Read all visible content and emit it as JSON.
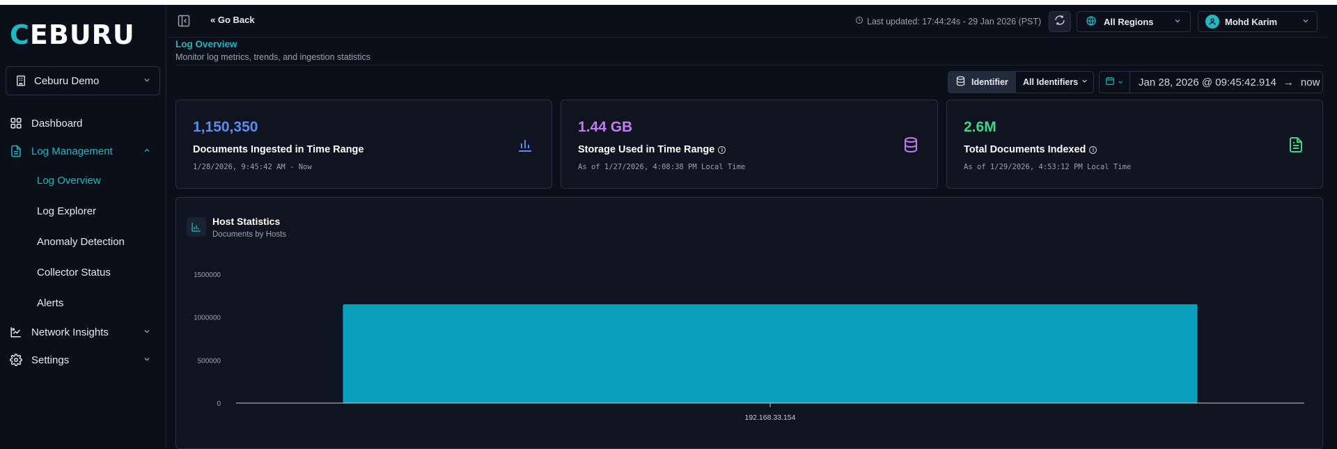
{
  "brand": {
    "logo_first": "C",
    "logo_rest": "EBURU"
  },
  "sidebar": {
    "workspace": "Ceburu Demo",
    "nav": [
      {
        "label": "Dashboard",
        "icon": "dashboard-icon"
      },
      {
        "label": "Log Management",
        "icon": "document-icon",
        "active": true,
        "expanded": true
      },
      {
        "label": "Network Insights",
        "icon": "network-chart-icon"
      },
      {
        "label": "Settings",
        "icon": "gear-icon"
      }
    ],
    "log_sub": [
      "Log Overview",
      "Log Explorer",
      "Anomaly Detection",
      "Collector Status",
      "Alerts"
    ],
    "active_sub": "Log Overview"
  },
  "topbar": {
    "go_back": "Go Back",
    "last_updated": "Last updated: 17:44:24s - 29 Jan 2026 (PST)",
    "region": "All Regions",
    "user": "Mohd Karim"
  },
  "page": {
    "title": "Log Overview",
    "subtitle": "Monitor log metrics, trends, and ingestion statistics"
  },
  "filters": {
    "identifier_label": "Identifier",
    "identifier_value": "All Identifiers",
    "range_from": "Jan 28, 2026 @ 09:45:42.914",
    "range_to": "now"
  },
  "cards": [
    {
      "value": "1,150,350",
      "label": "Documents Ingested in Time Range",
      "meta": "1/28/2026, 9:45:42 AM - Now",
      "color": "#5b8def",
      "icon": "bar-chart-icon"
    },
    {
      "value": "1.44 GB",
      "label": "Storage Used in Time Range",
      "meta": "As of 1/27/2026, 4:08:38 PM Local Time",
      "color": "#c17cf0",
      "icon": "database-icon"
    },
    {
      "value": "2.6M",
      "label": "Total Documents Indexed",
      "meta": "As of 1/29/2026, 4:53:12 PM Local Time",
      "color": "#3fd68a",
      "icon": "file-text-icon"
    }
  ],
  "panel": {
    "title": "Host Statistics",
    "subtitle": "Documents by Hosts"
  },
  "chart_data": {
    "type": "bar",
    "title": "Host Statistics",
    "subtitle": "Documents by Hosts",
    "categories": [
      "192.168.33.154"
    ],
    "values": [
      1150350
    ],
    "ylim": [
      0,
      1500000
    ],
    "yticks": [
      0,
      500000,
      1000000,
      1500000
    ],
    "ytick_labels": [
      "0",
      "500000",
      "1000000",
      "1500000"
    ],
    "bar_color": "#0aa0bd",
    "grid": false
  }
}
